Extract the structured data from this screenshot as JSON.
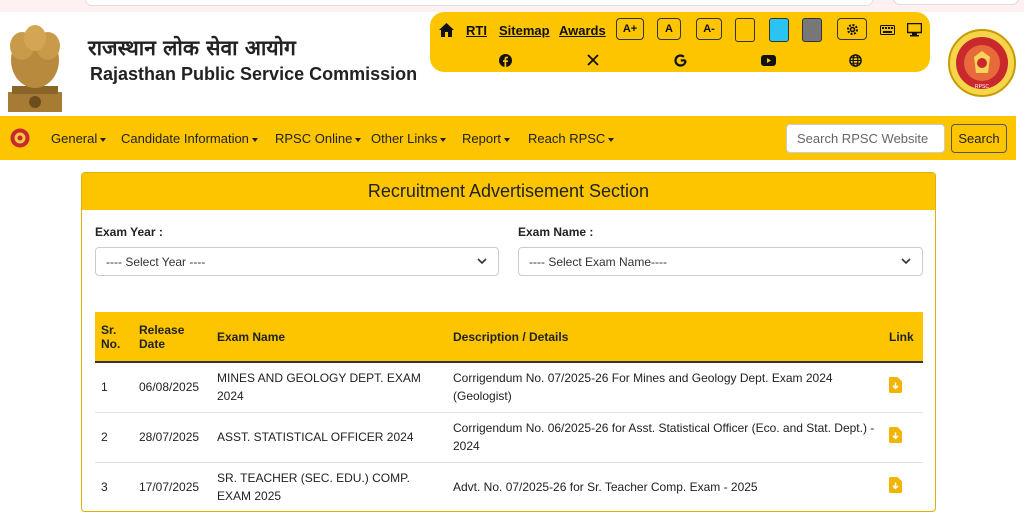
{
  "header": {
    "org_name_hindi": "राजस्थान लोक सेवा आयोग",
    "org_name_english": "Rajasthan Public Service Commission",
    "seal_text": "RPSC"
  },
  "toolbar": {
    "links": {
      "rti": "RTI",
      "sitemap": "Sitemap",
      "awards": "Awards"
    },
    "font_buttons": {
      "increase": "A+",
      "normal": "A",
      "decrease": "A-"
    },
    "contrast_swatches": [
      "#fcc500",
      "#2bc3f2",
      "#777777"
    ],
    "social_icons": [
      "facebook-icon",
      "x-icon",
      "google-icon",
      "youtube-icon",
      "globe-icon"
    ]
  },
  "navbar": {
    "items": [
      "General",
      "Candidate Information",
      "RPSC Online",
      "Other Links",
      "Report",
      "Reach RPSC"
    ],
    "search_placeholder": "Search RPSC Website",
    "search_button": "Search"
  },
  "section": {
    "title": "Recruitment Advertisement Section",
    "exam_year_label": "Exam Year :",
    "exam_year_selected": "---- Select Year ----",
    "exam_name_label": "Exam Name :",
    "exam_name_selected": "---- Select Exam Name----"
  },
  "table": {
    "headers": {
      "sr": "Sr. No.",
      "release": "Release Date",
      "exam": "Exam Name",
      "desc": "Description / Details",
      "link": "Link"
    },
    "rows": [
      {
        "sr": "1",
        "date": "06/08/2025",
        "exam": "MINES AND GEOLOGY DEPT. EXAM 2024",
        "desc": "Corrigendum No. 07/2025-26 For Mines and Geology Dept. Exam 2024 (Geologist)"
      },
      {
        "sr": "2",
        "date": "28/07/2025",
        "exam": "ASST. STATISTICAL OFFICER 2024",
        "desc": "Corrigendum No. 06/2025-26 for Asst. Statistical Officer (Eco. and Stat. Dept.) - 2024"
      },
      {
        "sr": "3",
        "date": "17/07/2025",
        "exam": "SR. TEACHER (SEC. EDU.) COMP. EXAM 2025",
        "desc": "Advt. No. 07/2025-26 for Sr. Teacher Comp. Exam - 2025"
      }
    ]
  },
  "colors": {
    "accent": "#fcc500",
    "link_icon": "#f2b400"
  }
}
